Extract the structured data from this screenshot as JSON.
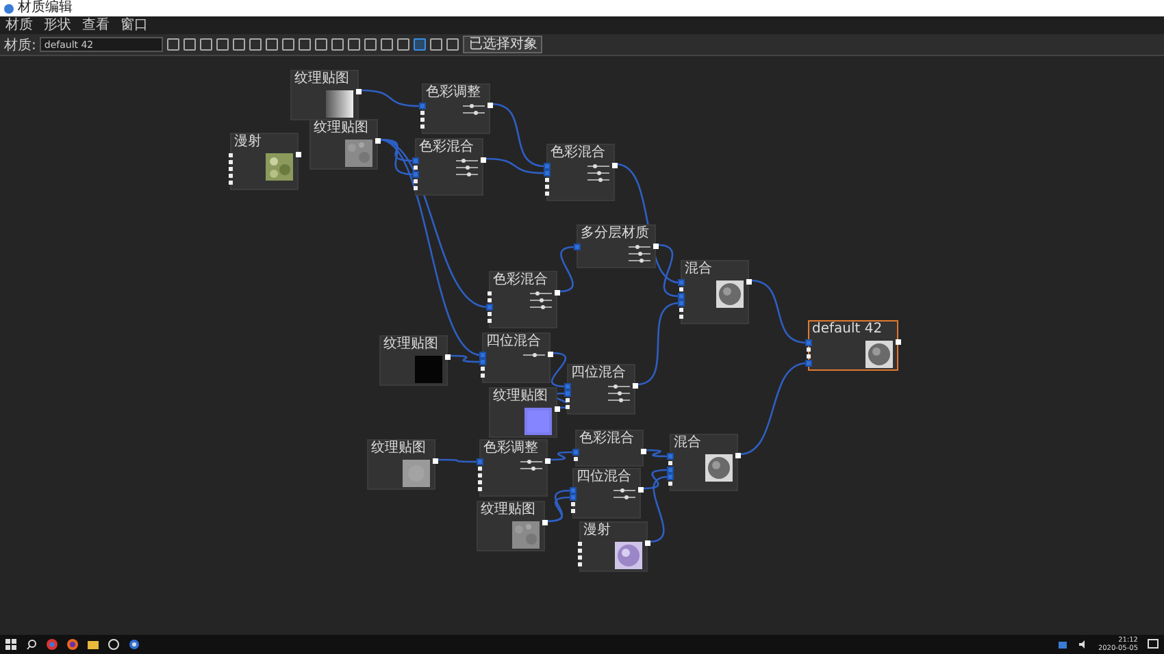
{
  "window": {
    "title": "材质编辑"
  },
  "menu": [
    "材质",
    "形状",
    "查看",
    "窗口"
  ],
  "toolbar": {
    "label": "材质:",
    "field_value": "default 42",
    "button": "已选择对象"
  },
  "nodes": [
    {
      "title": "纹理贴图",
      "selected": false,
      "kind": "gradient"
    },
    {
      "title": "纹理贴图",
      "selected": false,
      "kind": "noise"
    },
    {
      "title": "漫射",
      "selected": false,
      "kind": "leaf",
      "ports": [
        {
          "linked": false
        },
        {
          "linked": false
        },
        {
          "linked": false
        },
        {
          "linked": false
        },
        {
          "linked": false
        }
      ]
    },
    {
      "title": "色彩调整",
      "selected": false,
      "ports": [
        {
          "linked": true
        },
        {
          "linked": false
        },
        {
          "linked": false
        },
        {
          "linked": false
        }
      ],
      "sliders": [
        {
          "level": 0.4
        },
        {
          "level": 0.6
        }
      ]
    },
    {
      "title": "色彩混合",
      "selected": false,
      "ports": [
        {
          "linked": true
        },
        {
          "linked": false
        },
        {
          "linked": true
        },
        {
          "linked": false
        },
        {
          "linked": false
        }
      ],
      "sliders": [
        {
          "level": 0.3
        },
        {
          "level": 0.5
        },
        {
          "level": 0.6
        }
      ]
    },
    {
      "title": "色彩混合",
      "selected": false,
      "ports": [
        {
          "linked": true
        },
        {
          "linked": true
        },
        {
          "linked": false
        },
        {
          "linked": false
        },
        {
          "linked": false
        }
      ],
      "sliders": [
        {
          "level": 0.3
        },
        {
          "level": 0.5
        },
        {
          "level": 0.6
        }
      ]
    },
    {
      "title": "多分层材质",
      "selected": false,
      "ports": [
        {
          "linked": true
        }
      ],
      "sliders": [
        {
          "level": 0.4
        },
        {
          "level": 0.5
        },
        {
          "level": 0.6
        }
      ]
    },
    {
      "title": "色彩混合",
      "selected": false,
      "ports": [
        {
          "linked": false
        },
        {
          "linked": false
        },
        {
          "linked": true
        },
        {
          "linked": false
        },
        {
          "linked": false
        }
      ],
      "sliders": [
        {
          "level": 0.3
        },
        {
          "level": 0.5
        },
        {
          "level": 0.6
        }
      ]
    },
    {
      "title": "纹理贴图",
      "selected": false,
      "kind": "black"
    },
    {
      "title": "四位混合",
      "selected": false,
      "ports": [
        {
          "linked": true
        },
        {
          "linked": true
        },
        {
          "linked": false
        },
        {
          "linked": false
        }
      ],
      "sliders": [
        {
          "level": 0.5
        }
      ]
    },
    {
      "title": "纹理贴图",
      "selected": false,
      "kind": "violet"
    },
    {
      "title": "四位混合",
      "selected": false,
      "ports": [
        {
          "linked": true
        },
        {
          "linked": true
        },
        {
          "linked": false
        },
        {
          "linked": false
        }
      ],
      "sliders": [
        {
          "level": 0.3
        },
        {
          "level": 0.5
        },
        {
          "level": 0.6
        }
      ]
    },
    {
      "title": "混合",
      "selected": false,
      "kind": "sphere",
      "ports": [
        {
          "linked": true
        },
        {
          "linked": false
        },
        {
          "linked": true
        },
        {
          "linked": true
        },
        {
          "linked": false
        },
        {
          "linked": false
        }
      ]
    },
    {
      "title": "default 42",
      "selected": true,
      "kind": "sphere",
      "ports": [
        {
          "linked": true
        },
        {
          "linked": false
        },
        {
          "linked": false
        },
        {
          "linked": true
        }
      ]
    },
    {
      "title": "纹理贴图",
      "selected": false,
      "kind": "gray"
    },
    {
      "title": "色彩调整",
      "selected": false,
      "ports": [
        {
          "linked": true
        },
        {
          "linked": false
        },
        {
          "linked": false
        },
        {
          "linked": false
        },
        {
          "linked": false
        }
      ],
      "sliders": [
        {
          "level": 0.4
        },
        {
          "level": 0.6
        }
      ]
    },
    {
      "title": "色彩混合",
      "selected": false,
      "ports": [
        {
          "linked": true
        },
        {
          "linked": false
        }
      ]
    },
    {
      "title": "四位混合",
      "selected": false,
      "ports": [
        {
          "linked": true
        },
        {
          "linked": true
        },
        {
          "linked": false
        },
        {
          "linked": false
        }
      ],
      "sliders": [
        {
          "level": 0.4
        },
        {
          "level": 0.6
        }
      ]
    },
    {
      "title": "纹理贴图",
      "selected": false,
      "kind": "noise"
    },
    {
      "title": "混合",
      "selected": false,
      "kind": "sphere",
      "ports": [
        {
          "linked": true
        },
        {
          "linked": false
        },
        {
          "linked": true
        },
        {
          "linked": true
        },
        {
          "linked": false
        }
      ]
    },
    {
      "title": "漫射",
      "selected": false,
      "kind": "violet-sphere",
      "ports": [
        {
          "linked": false
        },
        {
          "linked": false
        },
        {
          "linked": false
        },
        {
          "linked": false
        }
      ]
    }
  ],
  "taskbar": {
    "time": "21:12",
    "date": "2020-05-05"
  }
}
